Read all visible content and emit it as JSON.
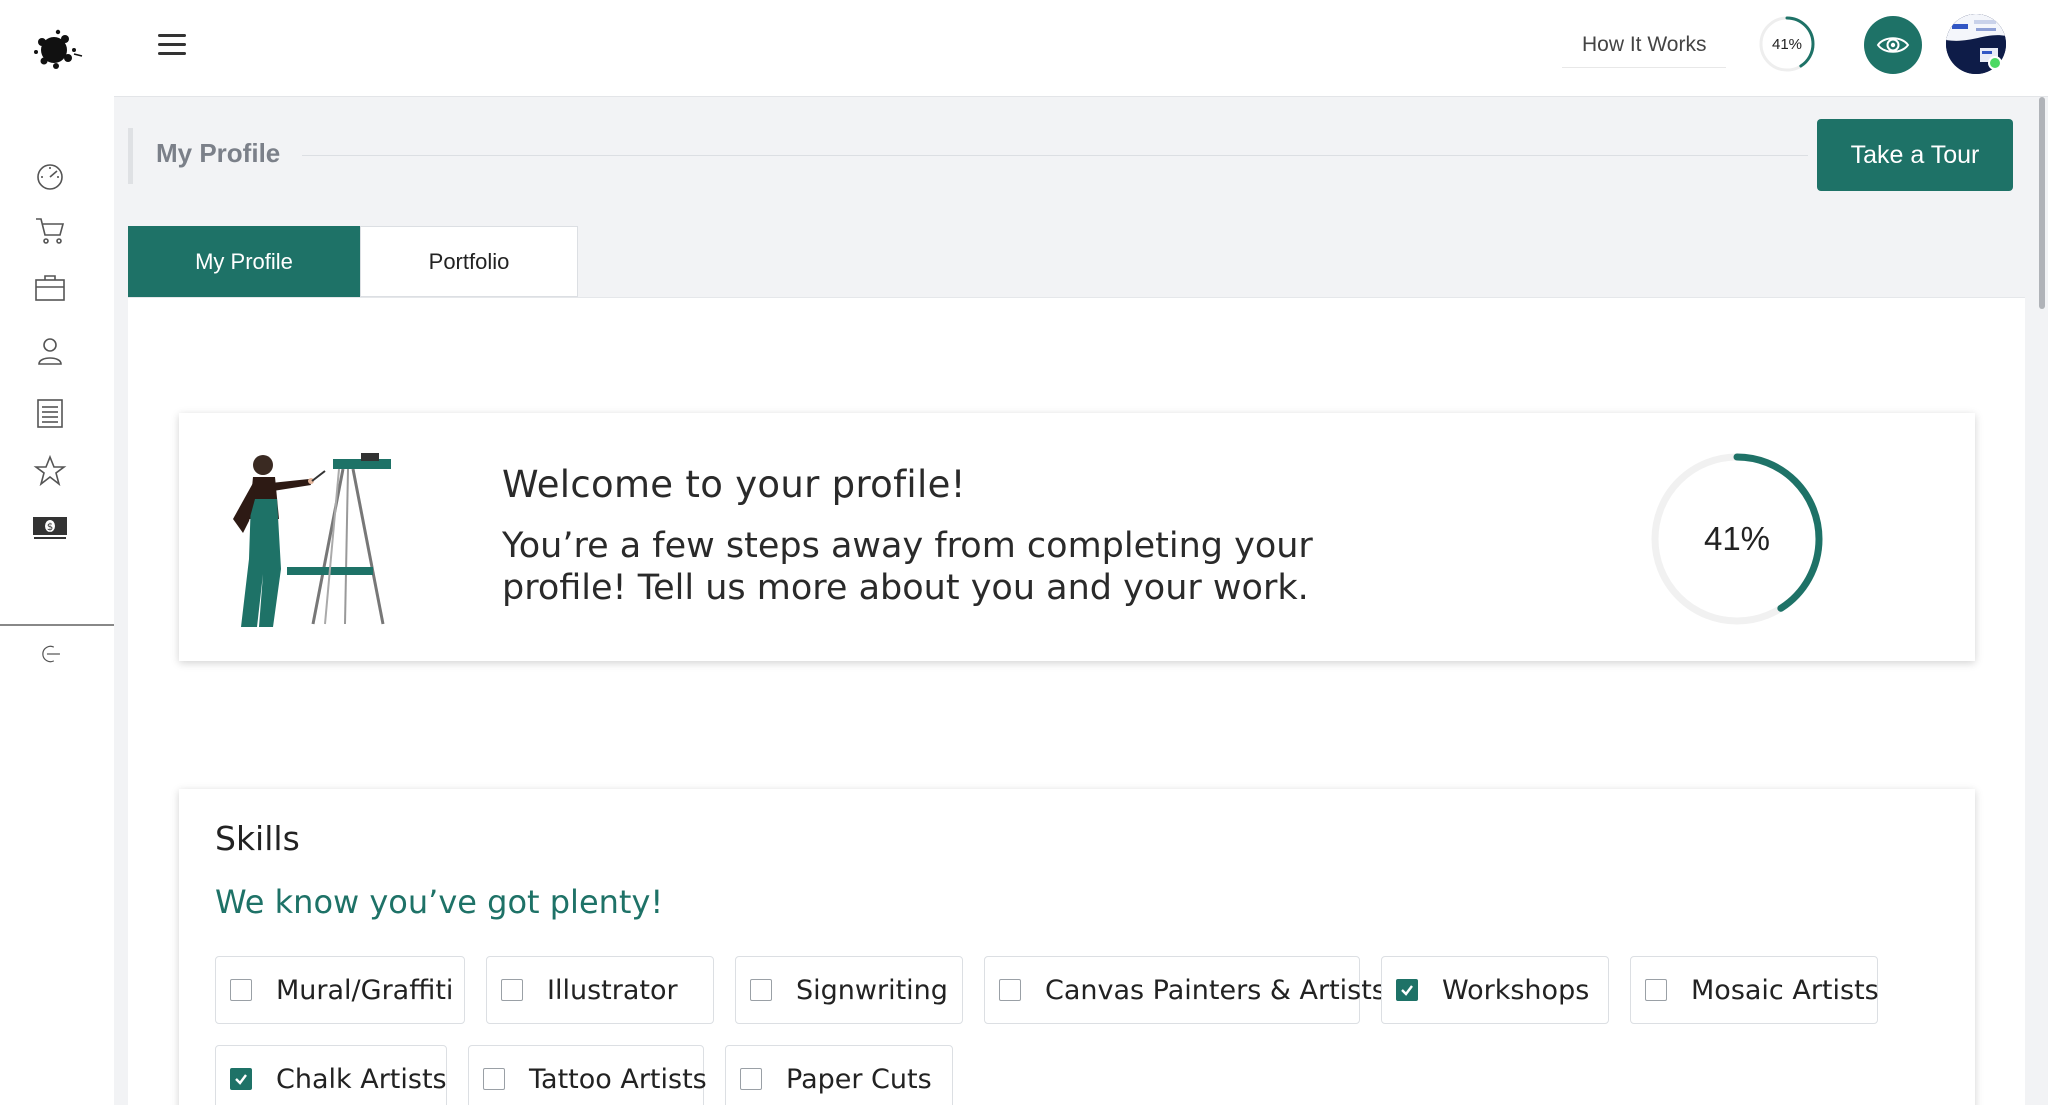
{
  "header": {
    "how_it_works_label": "How It Works",
    "mini_progress_label": "41%",
    "mini_progress_value": 41
  },
  "page": {
    "title": "My Profile",
    "tour_button_label": "Take a Tour"
  },
  "tabs": [
    {
      "label": "My Profile",
      "active": true
    },
    {
      "label": "Portfolio",
      "active": false
    }
  ],
  "welcome": {
    "title": "Welcome to your profile!",
    "text": "You’re a few steps away from completing your profile! Tell us more about you and your work.",
    "progress_label": "41%",
    "progress_value": 41
  },
  "skills": {
    "title": "Skills",
    "subtitle": "We know you’ve got plenty!",
    "items": [
      {
        "label": "Mural/Graffiti",
        "checked": false
      },
      {
        "label": "Illustrator",
        "checked": false
      },
      {
        "label": "Signwriting",
        "checked": false
      },
      {
        "label": "Canvas Painters & Artists",
        "checked": false
      },
      {
        "label": "Workshops",
        "checked": true
      },
      {
        "label": "Mosaic Artists",
        "checked": false
      },
      {
        "label": "Chalk Artists",
        "checked": true
      },
      {
        "label": "Tattoo Artists",
        "checked": false
      },
      {
        "label": "Paper Cuts",
        "checked": false
      }
    ]
  },
  "colors": {
    "accent": "#1e7267",
    "online": "#4cd964"
  },
  "sidebar": {
    "icons": [
      "dashboard-icon",
      "cart-icon",
      "briefcase-icon",
      "user-icon",
      "document-icon",
      "star-icon",
      "money-icon",
      "logout-icon"
    ]
  }
}
